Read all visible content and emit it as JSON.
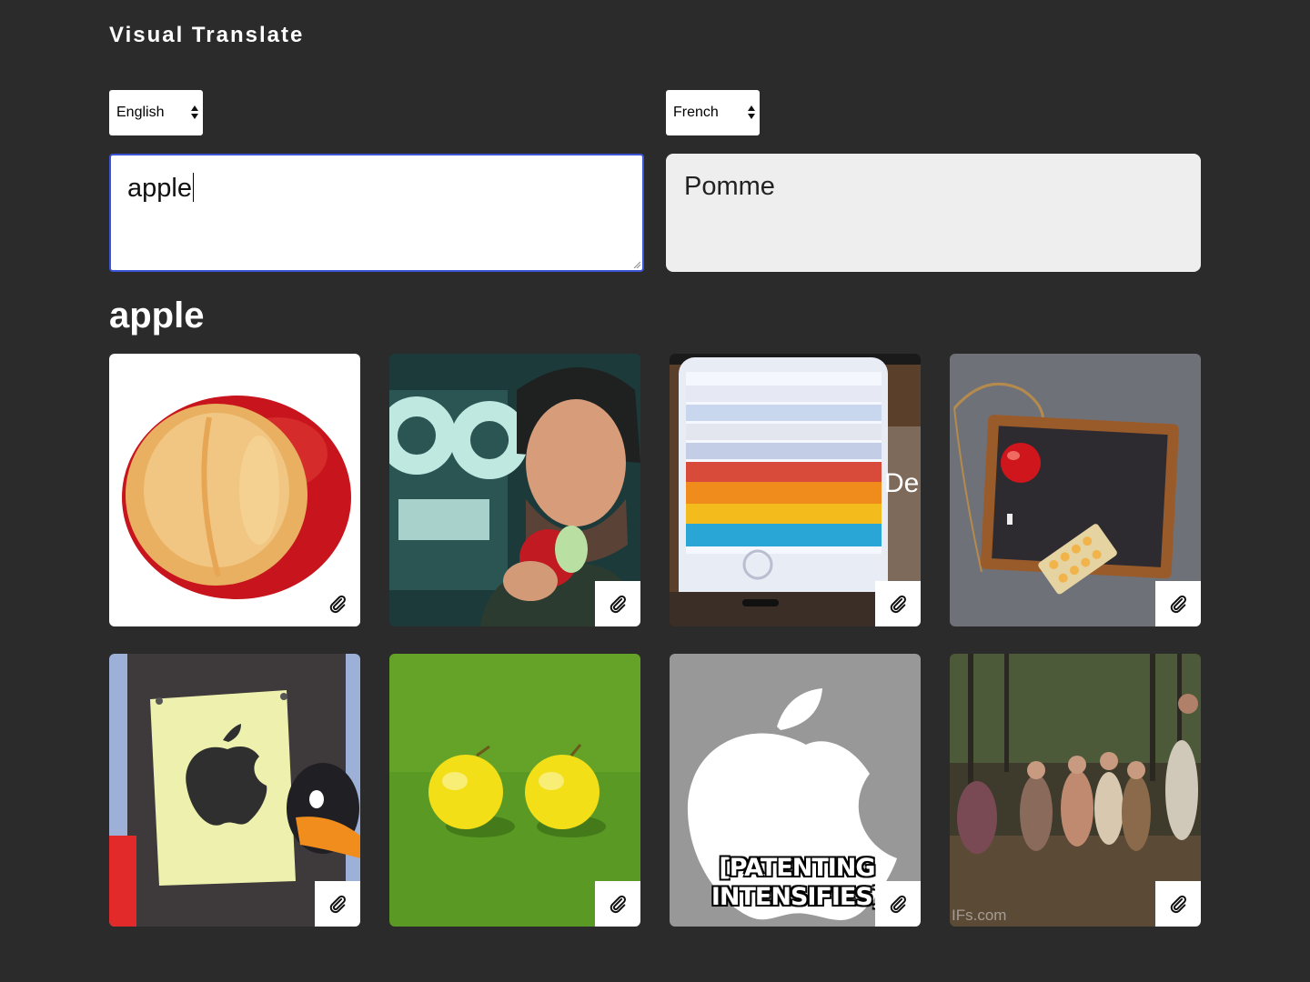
{
  "app": {
    "title": "Visual Translate"
  },
  "source_language": {
    "selected": "English"
  },
  "target_language": {
    "selected": "French"
  },
  "source_text": "apple",
  "translation": "Pomme",
  "results": {
    "heading": "apple",
    "images": [
      {
        "subject": "bitten red apple",
        "icon": "paperclip-icon"
      },
      {
        "subject": "man eating apple",
        "icon": "paperclip-icon"
      },
      {
        "subject": "iphone passbook",
        "icon": "paperclip-icon"
      },
      {
        "subject": "apple on chalkboard",
        "icon": "paperclip-icon"
      },
      {
        "subject": "cartoon apple logo sign",
        "icon": "paperclip-icon"
      },
      {
        "subject": "two yellow apples",
        "icon": "paperclip-icon"
      },
      {
        "subject": "apple logo meme",
        "icon": "paperclip-icon"
      },
      {
        "subject": "people dancing in forest",
        "icon": "paperclip-icon"
      }
    ],
    "overlays": {
      "phone_text": "De",
      "meme_line1": "[PATENTING",
      "meme_line2": "INTENSIFIES]",
      "watermark": "IFs.com"
    }
  }
}
